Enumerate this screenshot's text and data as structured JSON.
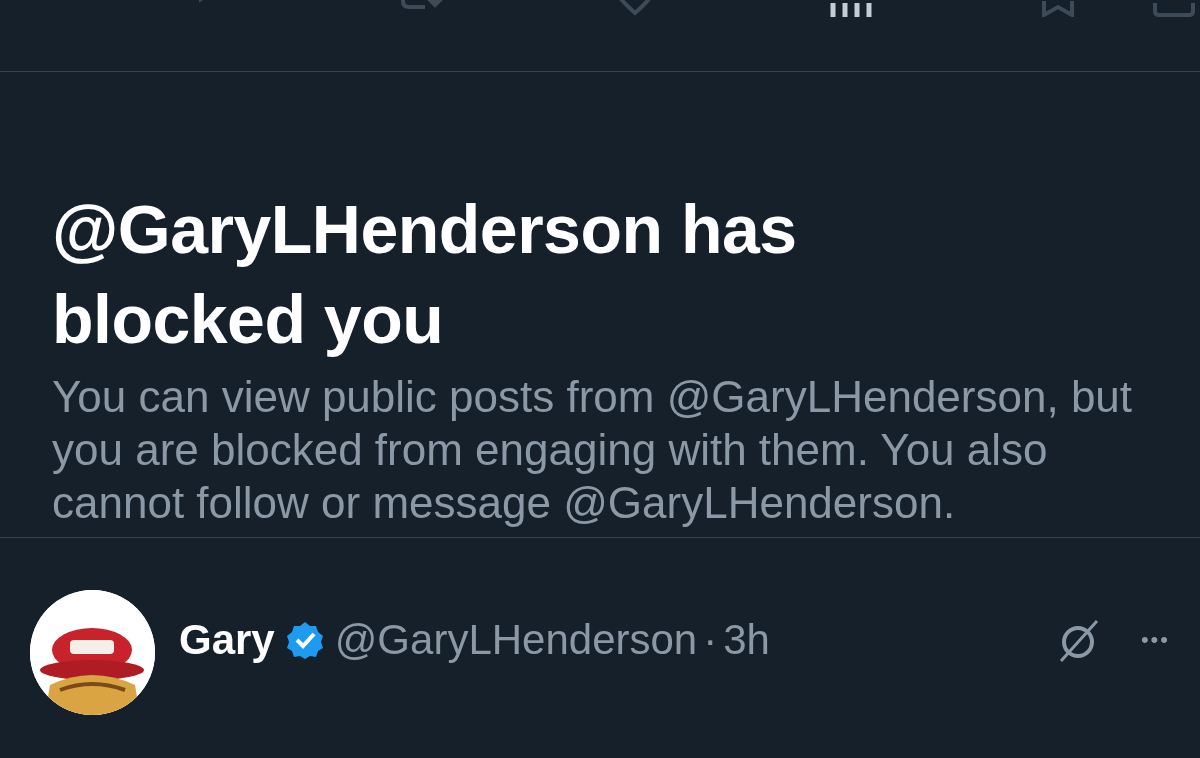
{
  "blocked_notice": {
    "title": "@GaryLHenderson has blocked you",
    "body": "You can view public posts from @GaryLHenderson, but you are blocked from engaging with them. You also cannot follow or message @GaryLHenderson."
  },
  "post": {
    "name": "Gary",
    "verified": true,
    "handle": "@GaryLHenderson",
    "separator": "·",
    "time": "3h",
    "more": "•••"
  }
}
